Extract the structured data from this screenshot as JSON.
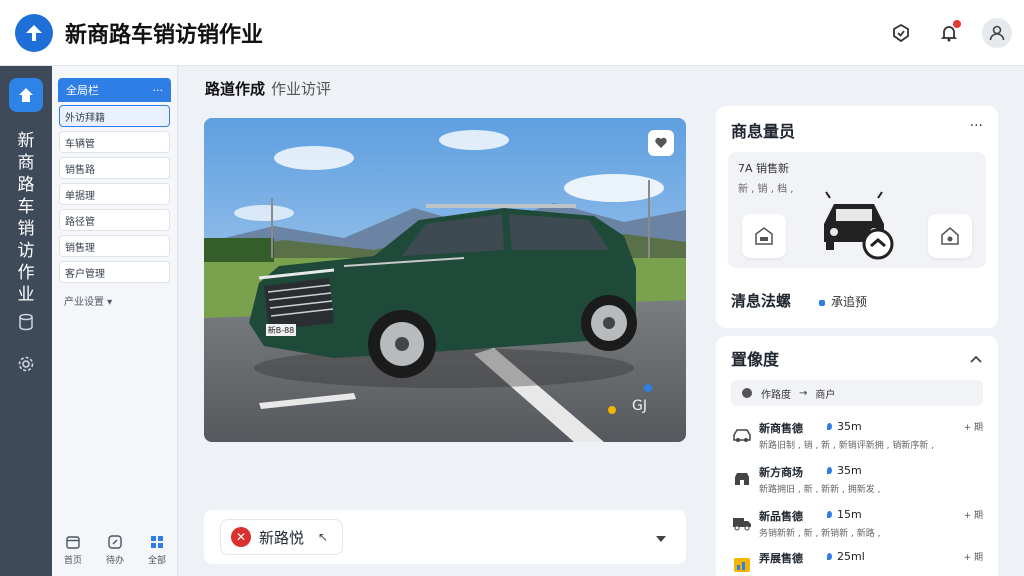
{
  "header": {
    "title": "新商路车销访销作业",
    "icons": [
      "app-logo-icon",
      "shield-check-icon",
      "bell-icon",
      "user-icon"
    ],
    "notification_dot": true
  },
  "rail": {
    "vertical_label": "新商路车销访作业",
    "icons": [
      "home-icon",
      "database-icon",
      "gear-icon"
    ]
  },
  "subnav": {
    "header": "全局栏",
    "header_more": "···",
    "items": [
      "外访拜籍",
      "车辆管",
      "销售路",
      "单据理",
      "路径管",
      "销售理",
      "客户管理"
    ],
    "more_label": "产业设置",
    "footer": [
      {
        "label": "首页",
        "icon": "calendar-icon"
      },
      {
        "label": "待办",
        "icon": "edit-icon"
      },
      {
        "label": "全部",
        "icon": "grid-icon"
      }
    ]
  },
  "main": {
    "breadcrumb_title": "路道作成",
    "breadcrumb_sub": "作业访评",
    "photo": {
      "plate": "新B-88",
      "tag": "GJ",
      "share_icon": "heart-icon"
    },
    "status": {
      "label": "新路悦",
      "mark": "↖"
    }
  },
  "panel": {
    "title": "商息量员",
    "more": "···",
    "vehicle_title": "7A 销售新",
    "vehicle_sub": "新 , 销 , 档 ,",
    "footer_label": "清息法螺",
    "footer_tag": "承追预"
  },
  "inventory": {
    "title": "置像度",
    "route_from": "作路度",
    "route_arrow": "→",
    "route_to": "商户",
    "items": [
      {
        "name": "新商售德",
        "distance": "35m",
        "sub": "新路旧制 , 销 , 新 , 新销评新拥 , 销新序新 ,",
        "action": "+ 期",
        "icon": "car-icon"
      },
      {
        "name": "新方商场",
        "distance": "35m",
        "sub": "新路拥旧 , 新 , 新新 , 拥新发 ,",
        "action": "",
        "icon": "store-icon"
      },
      {
        "name": "新品售德",
        "distance": "15m",
        "sub": "务销新新 , 新 , 新销新 , 新路 ,",
        "action": "+ 期",
        "icon": "truck-icon"
      },
      {
        "name": "弄展售德",
        "distance": "25ml",
        "sub": "",
        "action": "+ 期",
        "icon": "chart-icon"
      }
    ]
  },
  "colors": {
    "accent": "#2f7ee6",
    "rail": "#3e4a5a",
    "car_body": "#1f4a3a",
    "danger": "#d93030"
  }
}
